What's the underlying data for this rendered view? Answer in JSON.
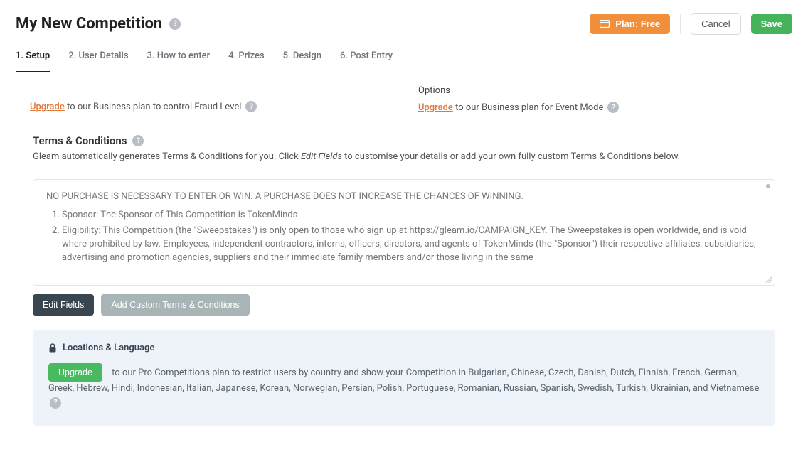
{
  "header": {
    "title": "My New Competition",
    "plan_label": "Plan: Free",
    "cancel_label": "Cancel",
    "save_label": "Save"
  },
  "tabs": [
    {
      "label": "1. Setup",
      "active": true
    },
    {
      "label": "2. User Details"
    },
    {
      "label": "3. How to enter"
    },
    {
      "label": "4. Prizes"
    },
    {
      "label": "5. Design"
    },
    {
      "label": "6. Post Entry"
    }
  ],
  "fraud": {
    "upgrade_link": "Upgrade",
    "text_after": " to our Business plan to control Fraud Level"
  },
  "event_mode": {
    "options_label": "Options",
    "upgrade_link": "Upgrade",
    "text_after": " to our Business plan for Event Mode"
  },
  "terms": {
    "title": "Terms & Conditions",
    "desc_prefix": "Gleam automatically generates Terms & Conditions for you. Click ",
    "desc_em": "Edit Fields",
    "desc_suffix": " to customise your details or add your own fully custom Terms & Conditions below.",
    "intro": "NO PURCHASE IS NECESSARY TO ENTER OR WIN. A PURCHASE DOES NOT INCREASE THE CHANCES OF WINNING.",
    "items": [
      "Sponsor: The Sponsor of This Competition is TokenMinds",
      "Eligibility: This Competition (the \"Sweepstakes\") is only open to those who sign up at https://gleam.io/CAMPAIGN_KEY. The Sweepstakes is open worldwide, and is void where prohibited by law. Employees, independent contractors, interns, officers, directors, and agents of TokenMinds (the \"Sponsor\") their respective affiliates, subsidiaries, advertising and promotion agencies, suppliers and their immediate family members and/or those living in the same"
    ],
    "edit_fields_btn": "Edit Fields",
    "add_custom_btn": "Add Custom Terms & Conditions"
  },
  "locations": {
    "title": "Locations & Language",
    "upgrade_btn": "Upgrade",
    "desc": " to our Pro Competitions plan to restrict users by country and show your Competition in Bulgarian, Chinese, Czech, Danish, Dutch, Finnish, French, German, Greek, Hebrew, Hindi, Indonesian, Italian, Japanese, Korean, Norwegian, Persian, Polish, Portuguese, Romanian, Russian, Spanish, Swedish, Turkish, Ukrainian, and Vietnamese"
  }
}
